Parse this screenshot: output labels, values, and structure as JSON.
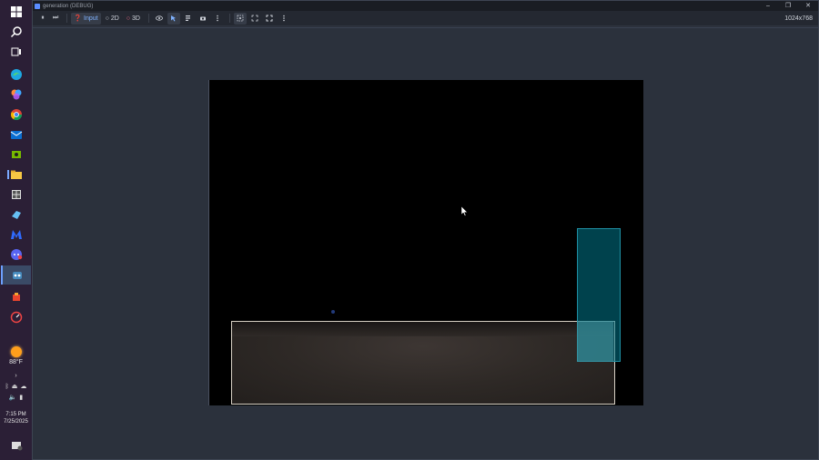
{
  "taskbar": {
    "icons": [
      "windows-start-icon",
      "search-icon",
      "task-view-icon",
      "edge-icon",
      "photos-icon",
      "chrome-icon",
      "mail-icon",
      "nvidia-icon",
      "file-explorer-icon",
      "store-icon",
      "steam-icon",
      "malwarebytes-icon",
      "discord-icon",
      "godot-icon",
      "office-icon",
      "speedometer-icon"
    ],
    "weather": {
      "temperature": "88°F"
    },
    "clock": {
      "time": "7:15 PM",
      "date": "7/25/2025"
    }
  },
  "window": {
    "title": "generation (DEBUG)",
    "controls": [
      "–",
      "❐",
      "✕"
    ]
  },
  "toolbar": {
    "pause_label": "⏸",
    "step_label": "⏭",
    "input_label": "Input",
    "label_2d": "2D",
    "label_3d": "3D",
    "resolution": "1024x768"
  },
  "colors": {
    "taskbar": "#2b1f36",
    "canvas": "#000000",
    "water": "#00788c",
    "accent": "#7fb2ff"
  }
}
